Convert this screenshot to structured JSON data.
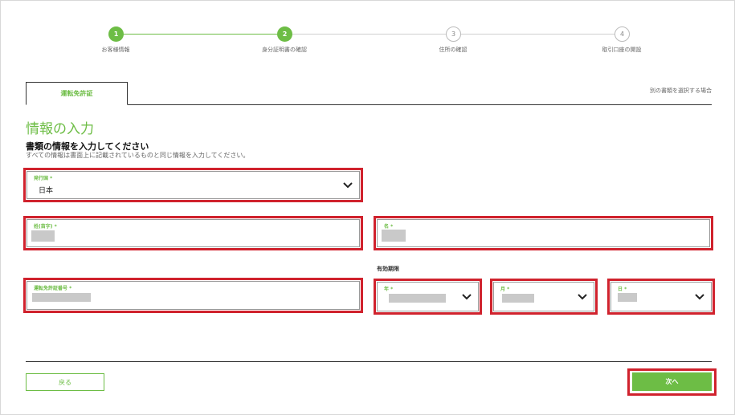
{
  "stepper": {
    "steps": [
      {
        "number": "1",
        "label": "お客様情報"
      },
      {
        "number": "2",
        "label": "身分証明書の確認"
      },
      {
        "number": "3",
        "label": "住所の確認"
      },
      {
        "number": "4",
        "label": "取引口座の開設"
      }
    ],
    "accent_color": "#6dbd45"
  },
  "tabs": {
    "active_label": "運転免許証",
    "other_link": "別の書類を選択する場合"
  },
  "header": {
    "title": "情報の入力",
    "section_title": "書類の情報を入力してください",
    "section_desc": "すべての情報は書面上に記載されているものと同じ情報を入力してください。"
  },
  "form": {
    "country": {
      "label": "発行国 *",
      "value": "日本"
    },
    "last_name": {
      "label": "姓(苗字) *"
    },
    "first_name": {
      "label": "名 *"
    },
    "license_number": {
      "label": "運転免許証番号 *"
    },
    "expiry_label": "有効期限",
    "year": {
      "label": "年 *"
    },
    "month": {
      "label": "月 *"
    },
    "day": {
      "label": "日 *"
    }
  },
  "footer": {
    "back_label": "戻る",
    "next_label": "次へ"
  },
  "highlight_color": "#d0222d"
}
